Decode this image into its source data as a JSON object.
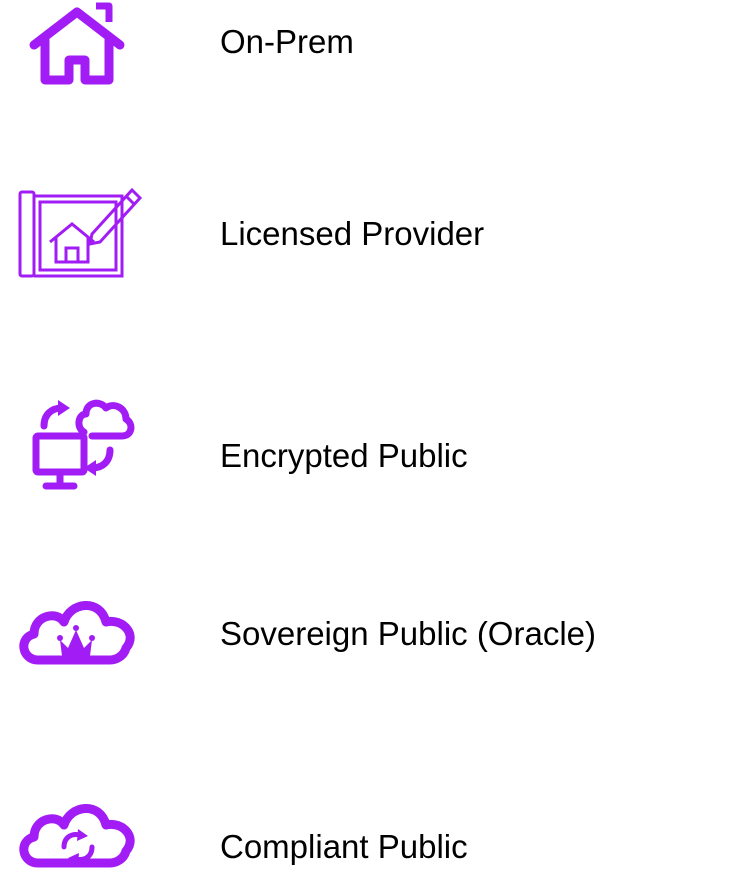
{
  "accent_color": "#a21cf5",
  "items": [
    {
      "label": "On-Prem",
      "icon": "house-icon"
    },
    {
      "label": "Licensed Provider",
      "icon": "blueprint-house-pencil-icon"
    },
    {
      "label": "Encrypted Public",
      "icon": "monitor-cloud-sync-icon"
    },
    {
      "label": "Sovereign Public (Oracle)",
      "icon": "cloud-crown-icon"
    },
    {
      "label": "Compliant Public",
      "icon": "cloud-refresh-icon"
    }
  ]
}
